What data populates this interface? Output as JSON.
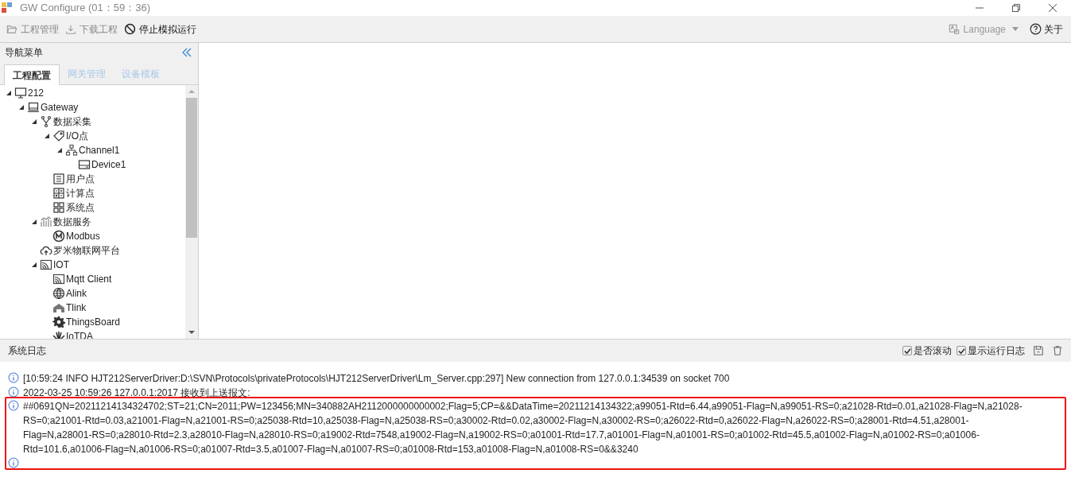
{
  "window": {
    "title": "GW Configure (01：59：36)"
  },
  "toolbar": [
    {
      "label": "工程管理",
      "kind": "folder",
      "disabled": true
    },
    {
      "label": "下载工程",
      "kind": "download",
      "disabled": true
    },
    {
      "label": "停止模拟运行",
      "kind": "stop",
      "disabled": false
    }
  ],
  "toolbar_right": {
    "language": {
      "label": "Language",
      "disabled": true
    },
    "about": {
      "label": "关于"
    }
  },
  "nav": {
    "title": "导航菜单",
    "tabs": [
      {
        "label": "工程配置",
        "selected": true
      },
      {
        "label": "网关管理",
        "selected": false
      },
      {
        "label": "设备模板",
        "selected": false
      }
    ],
    "tree": [
      {
        "label": "212",
        "kind": "monitor",
        "expanded": true,
        "children": [
          {
            "label": "Gateway",
            "kind": "gateway",
            "expanded": true,
            "children": [
              {
                "label": "数据采集",
                "kind": "fork",
                "expanded": true,
                "children": [
                  {
                    "label": "I/O点",
                    "kind": "tag",
                    "expanded": true,
                    "children": [
                      {
                        "label": "Channel1",
                        "kind": "network",
                        "expanded": true,
                        "children": [
                          {
                            "label": "Device1",
                            "kind": "device"
                          }
                        ]
                      }
                    ]
                  },
                  {
                    "label": "用户点",
                    "kind": "list"
                  },
                  {
                    "label": "计算点",
                    "kind": "calc"
                  },
                  {
                    "label": "系统点",
                    "kind": "grid"
                  }
                ]
              },
              {
                "label": "数据服务",
                "kind": "chart",
                "expanded": true,
                "children": [
                  {
                    "label": "Modbus",
                    "kind": "modbus"
                  }
                ]
              },
              {
                "label": "罗米物联网平台",
                "kind": "cloud"
              },
              {
                "label": "IOT",
                "kind": "cast",
                "expanded": true,
                "children": [
                  {
                    "label": "Mqtt Client",
                    "kind": "cast"
                  },
                  {
                    "label": "Alink",
                    "kind": "globe"
                  },
                  {
                    "label": "Tlink",
                    "kind": "house"
                  },
                  {
                    "label": "ThingsBoard",
                    "kind": "gear"
                  },
                  {
                    "label": "IoTDA",
                    "kind": "flower"
                  }
                ]
              }
            ]
          }
        ]
      }
    ]
  },
  "log": {
    "title": "系统日志",
    "options": [
      {
        "label": "是否滚动",
        "checked": true
      },
      {
        "label": "显示运行日志",
        "checked": true
      }
    ],
    "entries": [
      {
        "text": "[10:59:24 INFO HJT212ServerDriver:D:\\SVN\\Protocols\\privateProtocols\\HJT212ServerDriver\\Lm_Server.cpp:297] New connection from 127.0.0.1:34539 on socket 700",
        "highlighted": false
      },
      {
        "text": "2022-03-25 10:59:26 127.0.0.1:2017 接收到上送报文:",
        "highlighted": false
      },
      {
        "text": "##0691QN=20211214134324702;ST=21;CN=2011;PW=123456;MN=340882AH2112000000000002;Flag=5;CP=&&DataTime=20211214134322;a99051-Rtd=6.44,a99051-Flag=N,a99051-RS=0;a21028-Rtd=0.01,a21028-Flag=N,a21028-RS=0;a21001-Rtd=0.03,a21001-Flag=N,a21001-RS=0;a25038-Rtd=10,a25038-Flag=N,a25038-RS=0;a30002-Rtd=0.02,a30002-Flag=N,a30002-RS=0;a26022-Rtd=0,a26022-Flag=N,a26022-RS=0;a28001-Rtd=4.51,a28001-Flag=N,a28001-RS=0;a28010-Rtd=2.3,a28010-Flag=N,a28010-RS=0;a19002-Rtd=7548,a19002-Flag=N,a19002-RS=0;a01001-Rtd=17.7,a01001-Flag=N,a01001-RS=0;a01002-Rtd=45.5,a01002-Flag=N,a01002-RS=0;a01006-Rtd=101.6,a01006-Flag=N,a01006-RS=0;a01007-Rtd=3.5,a01007-Flag=N,a01007-RS=0;a01008-Rtd=153,a01008-Flag=N,a01008-RS=0&&3240",
        "highlighted": true
      },
      {
        "highlighted": true
      }
    ]
  }
}
